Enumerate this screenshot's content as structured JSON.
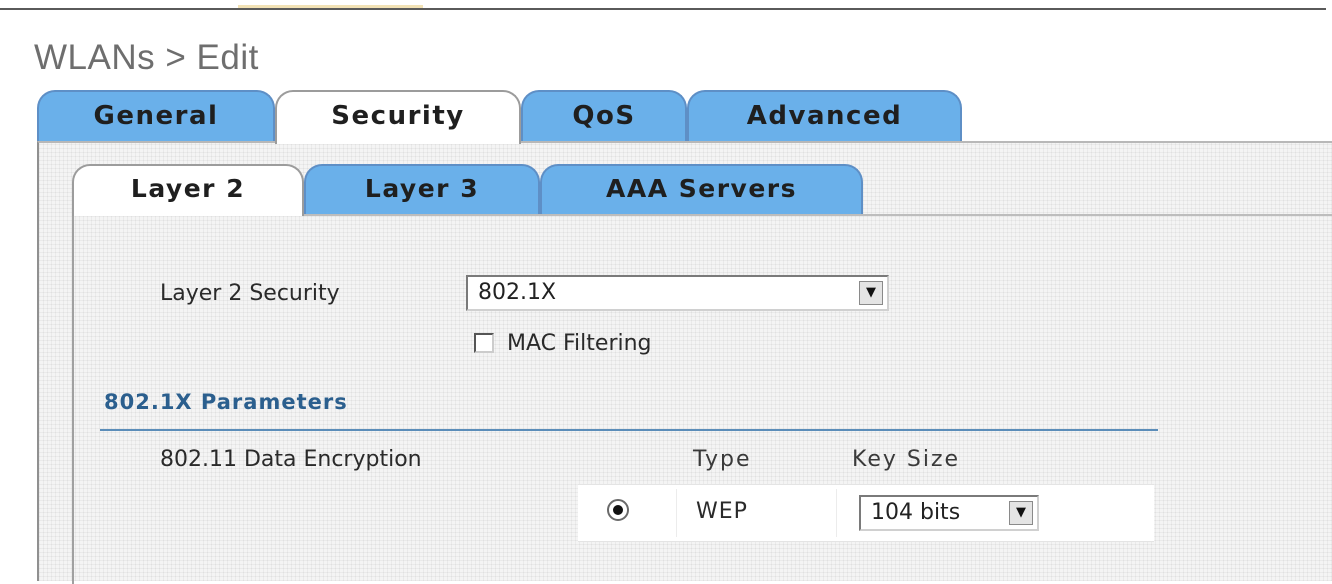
{
  "page": {
    "title": "WLANs > Edit"
  },
  "main_tabs": [
    {
      "label": "General",
      "active": false
    },
    {
      "label": "Security",
      "active": true
    },
    {
      "label": "QoS",
      "active": false
    },
    {
      "label": "Advanced",
      "active": false
    }
  ],
  "sub_tabs": [
    {
      "label": "Layer 2",
      "active": true
    },
    {
      "label": "Layer 3",
      "active": false
    },
    {
      "label": "AAA Servers",
      "active": false
    }
  ],
  "layer2": {
    "security_label": "Layer 2 Security",
    "security_value": "802.1X",
    "mac_filtering_label": "MAC Filtering",
    "mac_filtering_checked": false
  },
  "params": {
    "title": "802.1X Parameters",
    "encryption_label": "802.11 Data Encryption",
    "type_header": "Type",
    "keysize_header": "Key Size",
    "selected": true,
    "type_value": "WEP",
    "keysize_value": "104 bits"
  },
  "colors": {
    "tab_inactive": "#6ab0ea",
    "tab_active": "#ffffff",
    "section_title": "#2b5f8e",
    "section_rule": "#5b8db9"
  },
  "icons": {
    "dropdown": "chevron-down-icon",
    "radio": "radio-selected-icon",
    "checkbox": "checkbox-unchecked-icon"
  }
}
